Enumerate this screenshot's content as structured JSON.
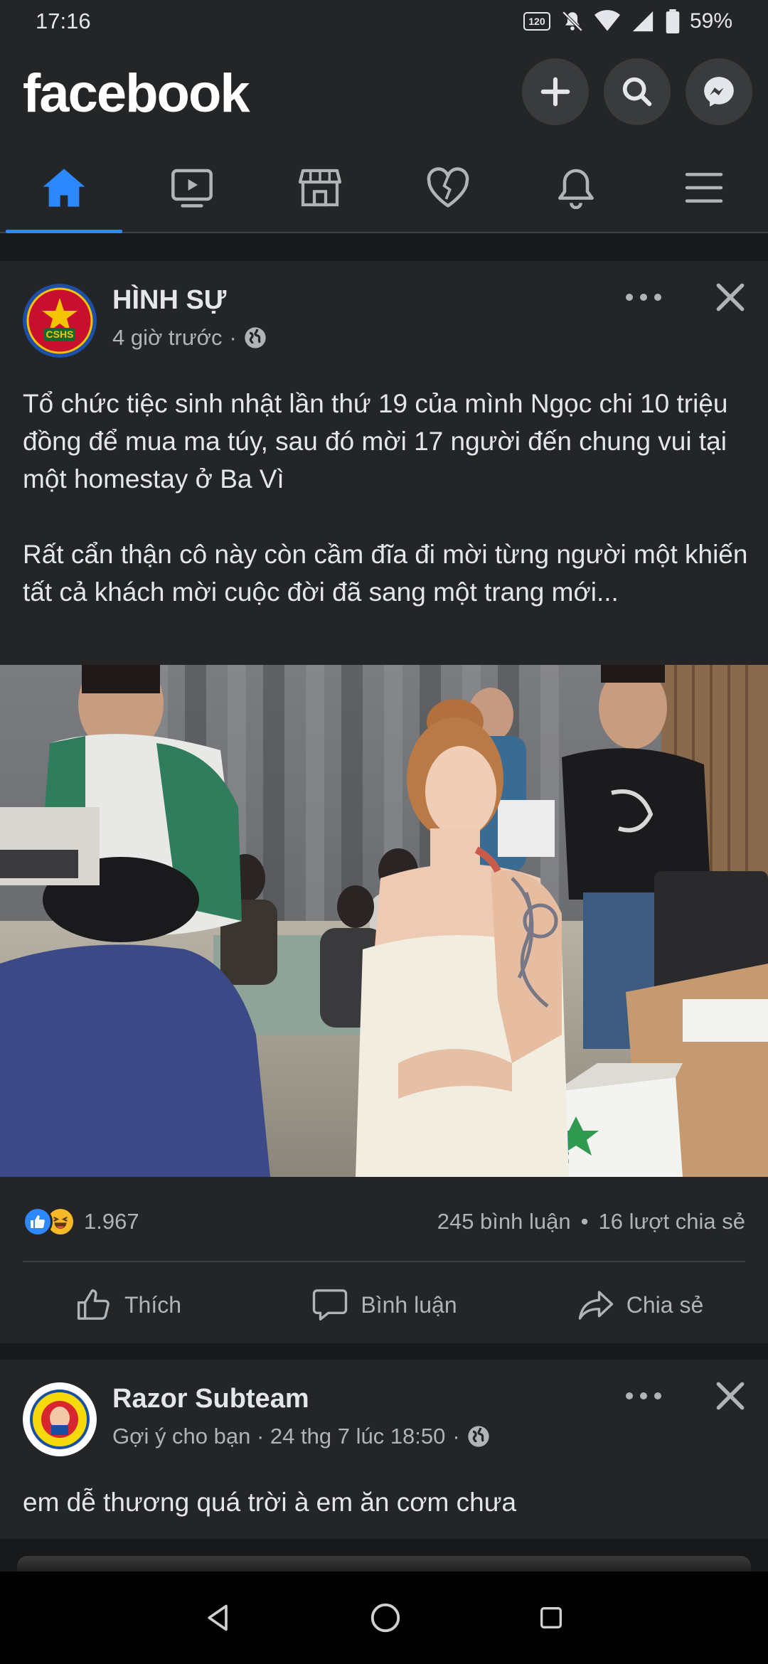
{
  "status": {
    "time": "17:16",
    "refresh_badge": "120",
    "battery": "59%"
  },
  "header": {
    "logo": "facebook"
  },
  "post1": {
    "author": "HÌNH SỰ",
    "avatar_text": "CSHS",
    "time": "4 giờ trước",
    "text_p1": "Tổ chức tiệc sinh nhật lần thứ 19 của mình Ngọc chi 10 triệu đồng để mua ma túy, sau đó mời 17 người đến chung vui tại một homestay ở Ba Vì",
    "text_p2": "Rất cẩn thận cô này còn cầm đĩa đi mời từng người một khiến tất cả khách mời cuộc đời đã sang một trang mới...",
    "reactions_count": "1.967",
    "comments": "245 bình luận",
    "shares": "16 lượt chia sẻ",
    "like_label": "Thích",
    "comment_label": "Bình luận",
    "share_label": "Chia sẻ",
    "photo_box_text": "sani"
  },
  "post2": {
    "author": "Razor Subteam",
    "meta": "Gợi ý cho bạn · 24 thg 7 lúc 18:50",
    "text": "em dễ thương quá trời à em ăn cơm chưa"
  },
  "colors": {
    "accent": "#2d88ff",
    "surface": "#242526",
    "background": "#18191a"
  }
}
